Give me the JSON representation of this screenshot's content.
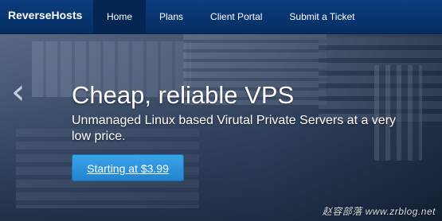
{
  "brand": "ReverseHosts",
  "nav": [
    {
      "label": "Home",
      "active": true
    },
    {
      "label": "Plans",
      "active": false
    },
    {
      "label": "Client Portal",
      "active": false
    },
    {
      "label": "Submit a Ticket",
      "active": false
    }
  ],
  "hero": {
    "prev_icon": "‹",
    "headline": "Cheap, reliable VPS",
    "subtext": "Unmanaged Linux based Virutal Private Servers at a very low price.",
    "cta_label": "Starting at $3.99"
  },
  "watermark": "赵容部落 www.zrblog.net",
  "colors": {
    "nav_bg": "#0a3a7a",
    "nav_active": "#052552",
    "cta": "#2b8fdc"
  }
}
